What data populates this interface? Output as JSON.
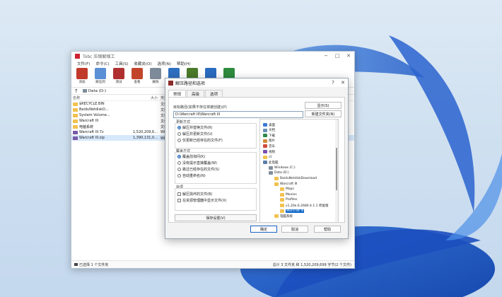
{
  "main_window": {
    "title": "Tobc 压缩解缩工",
    "menu": [
      "文件(F)",
      "命令(C)",
      "工具(S)",
      "收藏夹(O)",
      "选项(N)",
      "帮助(H)"
    ],
    "toolbar": [
      {
        "label": "添加",
        "icon": "add-archive-icon",
        "color": "#c0392b"
      },
      {
        "label": "解压到",
        "icon": "extract-folder-icon",
        "color": "#5b8fd6"
      },
      {
        "label": "测试",
        "icon": "test-icon",
        "color": "#b03030"
      },
      {
        "label": "查看",
        "icon": "view-icon",
        "color": "#c2452b"
      },
      {
        "label": "删除",
        "icon": "delete-icon",
        "color": "#7d8a99"
      },
      {
        "label": "查找",
        "icon": "find-icon",
        "color": "#2f6fc0"
      },
      {
        "label": "向导",
        "icon": "wizard-icon",
        "color": "#4a7a2a"
      },
      {
        "label": "信息",
        "icon": "info-icon",
        "color": "#2a6ac0"
      },
      {
        "label": "修复",
        "icon": "repair-icon",
        "color": "#2e8b3e"
      }
    ],
    "address": "Data (D:)",
    "columns": [
      "名称",
      "大小",
      "类型"
    ],
    "files": [
      {
        "name": "$RECYCLE.BIN",
        "size": "",
        "type": "文件夹",
        "icon": "folder-icon"
      },
      {
        "name": "BaiduNetdiskD...",
        "size": "",
        "type": "文件夹",
        "icon": "folder-icon"
      },
      {
        "name": "System Volume...",
        "size": "",
        "type": "文件夹",
        "icon": "folder-icon"
      },
      {
        "name": "Warcraft III",
        "size": "",
        "type": "文件夹",
        "icon": "folder-icon"
      },
      {
        "name": "电脑系统",
        "size": "",
        "type": "文件夹",
        "icon": "folder-icon"
      },
      {
        "name": "Warcraft III.7z",
        "size": "1,520,209,6...",
        "type": "WinRAR",
        "icon": "archive-icon"
      },
      {
        "name": "Warcraft III.zip",
        "size": "1,390,131,0...",
        "type": "WinRAR ZIP 文件",
        "icon": "archive-icon",
        "selected": true
      }
    ],
    "status_left": "已选择 1 个文件夹",
    "status_right": "总计 3 文件夹 和 1,520,209,699 字节(2 个文件)"
  },
  "dialog": {
    "title": "解压路径和选项",
    "tabs": [
      "常规",
      "高级",
      "选项"
    ],
    "target_label": "目标路径(如果不存在将被创建)(P)",
    "target_value": "D:\\Warcraft III\\Warcraft III",
    "show_button": "显示(S)",
    "new_folder_button": "新建文件夹(N)",
    "update_title": "更新方式",
    "update_options": [
      {
        "label": "解压并替换文件(R)",
        "checked": true
      },
      {
        "label": "解压并更新文件(U)",
        "checked": false
      },
      {
        "label": "仅更新已经存在的文件(F)",
        "checked": false
      }
    ],
    "overwrite_title": "覆盖方式",
    "overwrite_options": [
      {
        "label": "覆盖前询问(K)",
        "checked": true
      },
      {
        "label": "没有提示直接覆盖(W)",
        "checked": false
      },
      {
        "label": "跳过已经存在的文件(S)",
        "checked": false
      },
      {
        "label": "自动重命名(N)",
        "checked": false
      }
    ],
    "misc_title": "杂项",
    "misc_options": [
      {
        "label": "解压损坏的文件(B)",
        "checked": false
      },
      {
        "label": "在资源管理器中显示文件(X)",
        "checked": false
      }
    ],
    "save_button": "保存设置(V)",
    "tree": [
      {
        "label": "桌面",
        "level": 0,
        "icon": "desktop-icon"
      },
      {
        "label": "文档",
        "level": 0,
        "icon": "documents-icon"
      },
      {
        "label": "下载",
        "level": 0,
        "icon": "download-icon"
      },
      {
        "label": "图片",
        "level": 0,
        "icon": "pictures-icon"
      },
      {
        "label": "音乐",
        "level": 0,
        "icon": "music-icon"
      },
      {
        "label": "视频",
        "level": 0,
        "icon": "videos-icon"
      },
      {
        "label": "ct",
        "level": 0,
        "icon": "folder-icon"
      },
      {
        "label": "此电脑",
        "level": 0,
        "icon": "computer-icon"
      },
      {
        "label": "Windows (C:)",
        "level": 1,
        "icon": "drive-icon"
      },
      {
        "label": "Data (D:)",
        "level": 1,
        "icon": "drive-icon"
      },
      {
        "label": "BaiduNetdiskDownload",
        "level": 2,
        "icon": "folder-icon"
      },
      {
        "label": "Warcraft III",
        "level": 2,
        "icon": "folder-icon"
      },
      {
        "label": "Maps",
        "level": 3,
        "icon": "folder-icon"
      },
      {
        "label": "Movies",
        "level": 3,
        "icon": "folder-icon"
      },
      {
        "label": "Profiles",
        "level": 3,
        "icon": "folder-icon"
      },
      {
        "label": "v1.20e.6.2680.4.1.1 修复版",
        "level": 3,
        "icon": "folder-icon"
      },
      {
        "label": "Warcraft III",
        "level": 3,
        "icon": "folder-icon",
        "selected": true
      },
      {
        "label": "电脑系统",
        "level": 2,
        "icon": "folder-icon"
      }
    ],
    "ok_button": "确定",
    "cancel_button": "取消",
    "help_button": "帮助"
  }
}
